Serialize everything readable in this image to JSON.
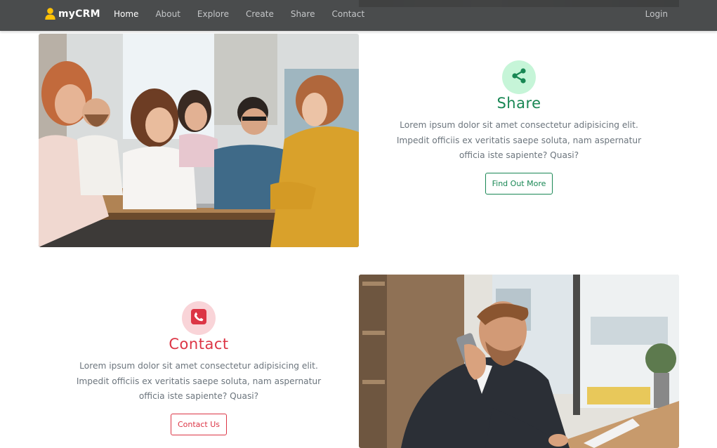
{
  "navbar": {
    "brand": "myCRM",
    "links": [
      "Home",
      "About",
      "Explore",
      "Create",
      "Share",
      "Contact"
    ],
    "active_link": "Home",
    "login": "Login"
  },
  "share": {
    "title": "Share",
    "text": "Lorem ipsum dolor sit amet consectetur adipisicing elit. Impedit officiis ex veritatis saepe soluta, nam aspernatur officia iste sapiente? Quasi?",
    "button": "Find Out More",
    "icon": "share-icon",
    "color": "#198754"
  },
  "contact": {
    "title": "Contact",
    "text": "Lorem ipsum dolor sit amet consectetur adipisicing elit. Impedit officiis ex veritatis saepe soluta, nam aspernatur officia iste sapiente? Quasi?",
    "button": "Contact Us",
    "icon": "phone-icon",
    "color": "#dc3545"
  },
  "colors": {
    "navbar_bg": "#3c3e40",
    "brand_icon": "#ffc107",
    "share_accent": "#198754",
    "contact_accent": "#dc3545",
    "body_text": "#6c757d"
  }
}
